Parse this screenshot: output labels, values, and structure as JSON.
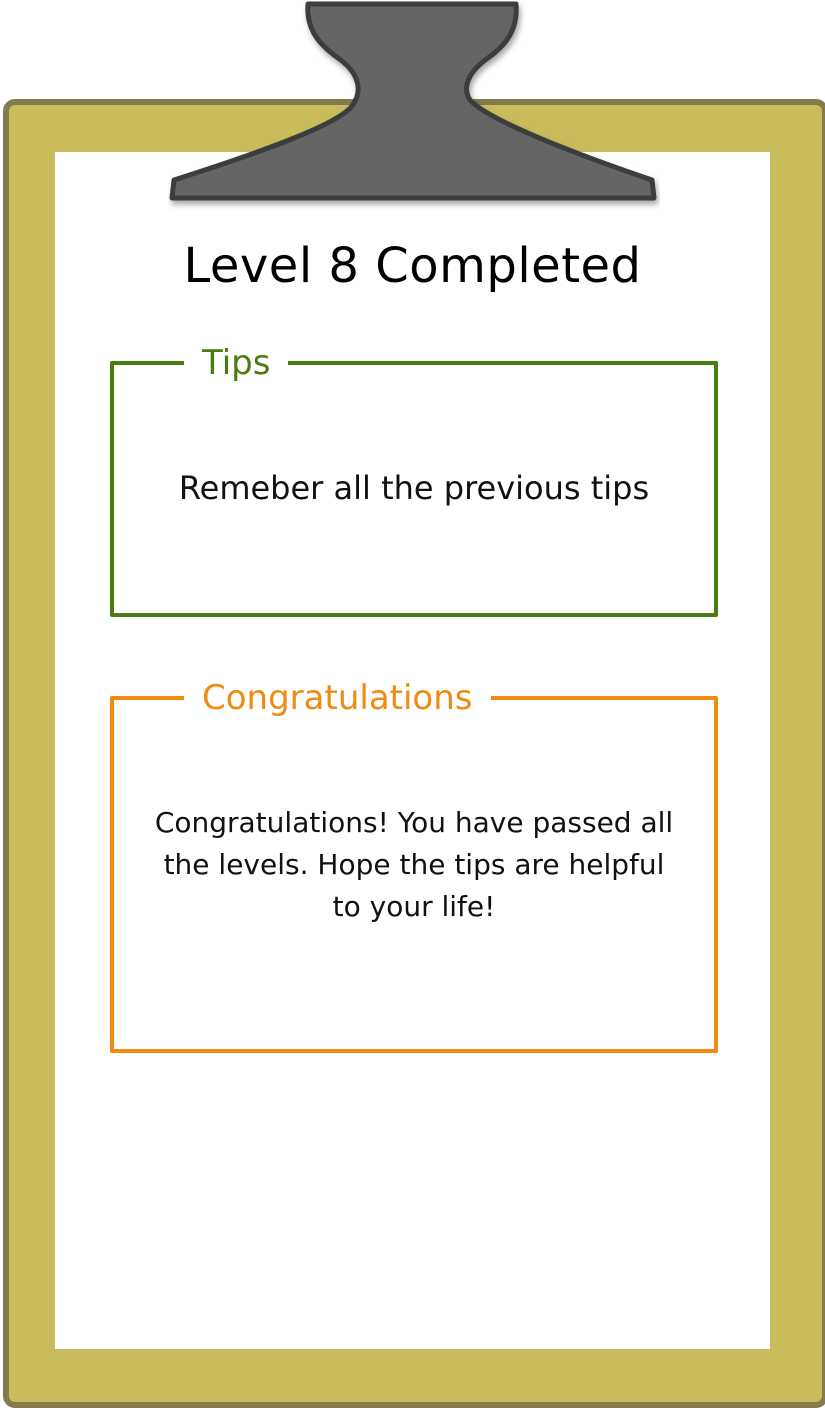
{
  "title": "Level 8 Completed",
  "tips": {
    "heading": "Tips",
    "text": "Remeber all the previous tips"
  },
  "congratulations": {
    "heading": "Congratulations",
    "text": "Congratulations! You have passed all the levels. Hope the tips are helpful to your life!"
  },
  "colors": {
    "board": "#c9bc5d",
    "board_border": "#837a4e",
    "clip": "#656565",
    "tips_accent": "#4a7d0f",
    "congrats_accent": "#f08a10"
  },
  "icons": {
    "clip": "clipboard-clip-icon"
  }
}
